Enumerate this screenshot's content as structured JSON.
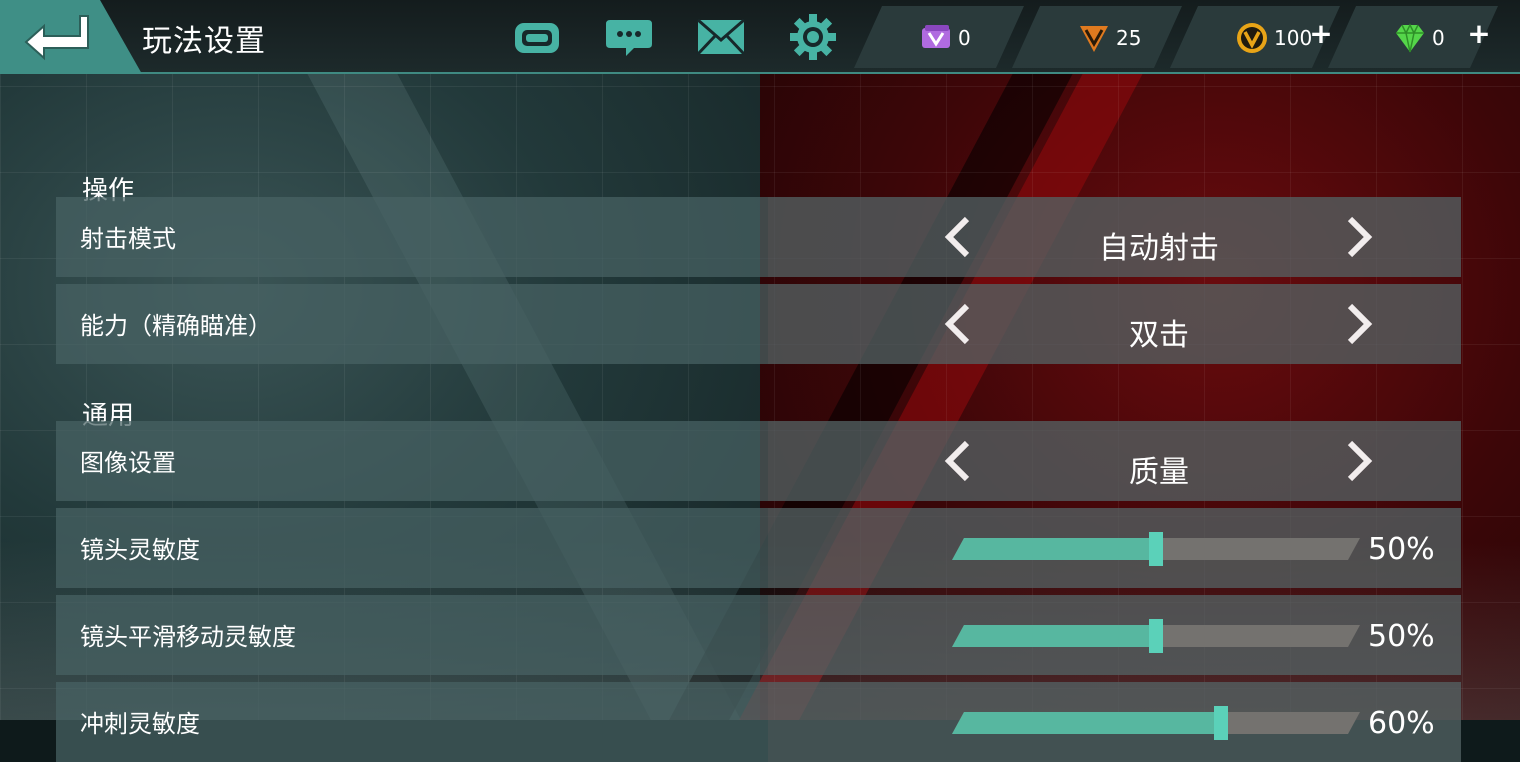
{
  "header": {
    "title": "玩法设置",
    "icons": [
      "gamepad-icon",
      "chat-icon",
      "mail-icon",
      "gear-icon"
    ]
  },
  "currencies": [
    {
      "name": "ticket",
      "icon": "ticket-icon",
      "value": "0",
      "has_plus": false,
      "color": "#a15bd0"
    },
    {
      "name": "v-points",
      "icon": "v-shield-icon",
      "value": "25",
      "has_plus": false,
      "color": "#e07a1f"
    },
    {
      "name": "v-coins",
      "icon": "v-coin-icon",
      "value": "100",
      "has_plus": true,
      "color": "#e8a417"
    },
    {
      "name": "gems",
      "icon": "gem-icon",
      "value": "0",
      "has_plus": true,
      "color": "#55d64a"
    }
  ],
  "sections": {
    "controls": {
      "title": "操作",
      "shooting_mode": {
        "label": "射击模式",
        "value": "自动射击"
      },
      "ability": {
        "label": "能力（精确瞄准）",
        "value": "双击"
      }
    },
    "general": {
      "title": "通用",
      "graphics": {
        "label": "图像设置",
        "value": "质量"
      },
      "camera_sensitivity": {
        "label": "镜头灵敏度",
        "value": "50%",
        "level": 0.5
      },
      "camera_smooth_sensitivity": {
        "label": "镜头平滑移动灵敏度",
        "value": "50%",
        "level": 0.5
      },
      "sprint_sensitivity": {
        "label": "冲刺灵敏度",
        "value": "60%",
        "level": 0.66
      }
    }
  },
  "colors": {
    "accent": "#4fc2a8",
    "thumb": "#54e0c4",
    "topbar_border": "#3f8a82",
    "back_button": "#3f8f86"
  }
}
